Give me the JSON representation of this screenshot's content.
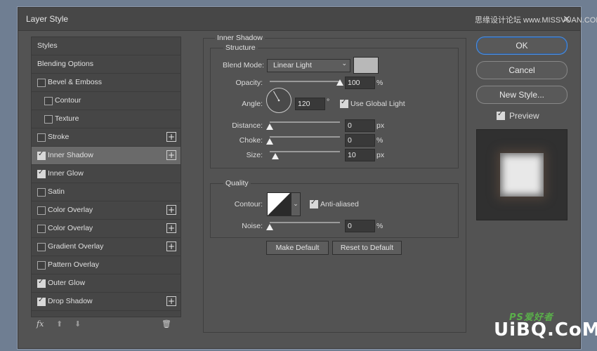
{
  "window": {
    "title": "Layer Style",
    "watermark_top": "思缘设计论坛 www.MISSVUAN.COM",
    "watermark_bottom": "UiBQ.CoM",
    "watermark_ps": "PS爱好者"
  },
  "sidebar": {
    "items": [
      {
        "label": "Styles",
        "checkbox": false,
        "checked": false,
        "plus": false,
        "indent": 0,
        "selected": false
      },
      {
        "label": "Blending Options",
        "checkbox": false,
        "checked": false,
        "plus": false,
        "indent": 0,
        "selected": false
      },
      {
        "label": "Bevel & Emboss",
        "checkbox": true,
        "checked": false,
        "plus": false,
        "indent": 0,
        "selected": false
      },
      {
        "label": "Contour",
        "checkbox": true,
        "checked": false,
        "plus": false,
        "indent": 1,
        "selected": false
      },
      {
        "label": "Texture",
        "checkbox": true,
        "checked": false,
        "plus": false,
        "indent": 1,
        "selected": false
      },
      {
        "label": "Stroke",
        "checkbox": true,
        "checked": false,
        "plus": true,
        "indent": 0,
        "selected": false
      },
      {
        "label": "Inner Shadow",
        "checkbox": true,
        "checked": true,
        "plus": true,
        "indent": 0,
        "selected": true
      },
      {
        "label": "Inner Glow",
        "checkbox": true,
        "checked": true,
        "plus": false,
        "indent": 0,
        "selected": false
      },
      {
        "label": "Satin",
        "checkbox": true,
        "checked": false,
        "plus": false,
        "indent": 0,
        "selected": false
      },
      {
        "label": "Color Overlay",
        "checkbox": true,
        "checked": false,
        "plus": true,
        "indent": 0,
        "selected": false
      },
      {
        "label": "Color Overlay",
        "checkbox": true,
        "checked": false,
        "plus": true,
        "indent": 0,
        "selected": false
      },
      {
        "label": "Gradient Overlay",
        "checkbox": true,
        "checked": false,
        "plus": true,
        "indent": 0,
        "selected": false
      },
      {
        "label": "Pattern Overlay",
        "checkbox": true,
        "checked": false,
        "plus": false,
        "indent": 0,
        "selected": false
      },
      {
        "label": "Outer Glow",
        "checkbox": true,
        "checked": true,
        "plus": false,
        "indent": 0,
        "selected": false
      },
      {
        "label": "Drop Shadow",
        "checkbox": true,
        "checked": true,
        "plus": true,
        "indent": 0,
        "selected": false
      }
    ],
    "footer": {
      "fx": "fx",
      "up": "⬆",
      "down": "⬇",
      "trash": "🗑"
    }
  },
  "inner_shadow": {
    "section_title": "Inner Shadow",
    "structure_title": "Structure",
    "blend_mode_label": "Blend Mode:",
    "blend_mode_value": "Linear Light",
    "blend_color": "#b8b8b8",
    "opacity_label": "Opacity:",
    "opacity_value": "100",
    "opacity_unit": "%",
    "opacity_fraction": 1.0,
    "angle_label": "Angle:",
    "angle_value": "120",
    "angle_unit": "°",
    "use_global_light_label": "Use Global Light",
    "use_global_light": true,
    "distance_label": "Distance:",
    "distance_value": "0",
    "distance_unit": "px",
    "distance_fraction": 0.0,
    "choke_label": "Choke:",
    "choke_value": "0",
    "choke_unit": "%",
    "choke_fraction": 0.0,
    "size_label": "Size:",
    "size_value": "10",
    "size_unit": "px",
    "size_fraction": 0.08,
    "quality_title": "Quality",
    "contour_label": "Contour:",
    "anti_aliased_label": "Anti-aliased",
    "anti_aliased": true,
    "noise_label": "Noise:",
    "noise_value": "0",
    "noise_unit": "%",
    "noise_fraction": 0.0,
    "make_default_label": "Make Default",
    "reset_default_label": "Reset to Default"
  },
  "actions": {
    "ok_label": "OK",
    "cancel_label": "Cancel",
    "new_style_label": "New Style...",
    "preview_label": "Preview",
    "preview_checked": true
  },
  "colors": {
    "accent": "#4c8fe0",
    "dialog_bg": "#535353"
  }
}
